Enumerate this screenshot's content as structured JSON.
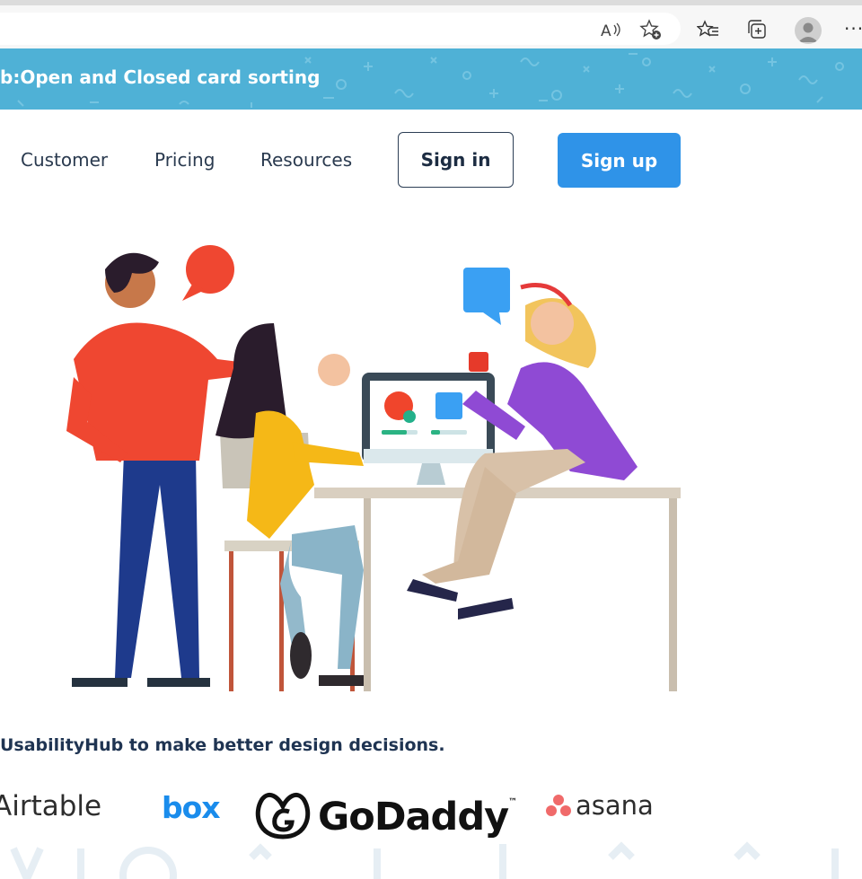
{
  "browser": {
    "icons": [
      "read-aloud-icon",
      "add-favorite-icon",
      "favorites-icon",
      "collections-icon",
      "profile-icon",
      "more-icon"
    ],
    "more_label": "···"
  },
  "banner": {
    "text": "b:Open and Closed card sorting",
    "color": "#4fb1d6"
  },
  "nav": {
    "links": [
      "Customer",
      "Pricing",
      "Resources"
    ],
    "signin_label": "Sign in",
    "signup_label": "Sign up",
    "accent": "#2f93e8"
  },
  "hero": {
    "illustration": "team-collaborating-at-computer"
  },
  "tagline": "UsabilityHub to make better design decisions.",
  "logos": {
    "airtable": "Airtable",
    "box": "box",
    "godaddy": "GoDaddy",
    "godaddy_tm": "™",
    "asana": "asana"
  }
}
